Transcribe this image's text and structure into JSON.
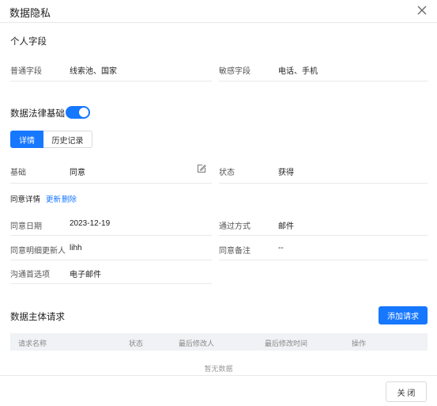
{
  "dialog": {
    "title": "数据隐私",
    "close_icon": "close-icon"
  },
  "personal_fields": {
    "title": "个人字段",
    "normal_label": "普通字段",
    "normal_value": "线索池、国家",
    "sensitive_label": "敏感字段",
    "sensitive_value": "电话、手机"
  },
  "legal_basis": {
    "title": "数据法律基础",
    "toggle_on": true,
    "tabs": [
      {
        "label": "详情",
        "active": true
      },
      {
        "label": "历史记录",
        "active": false
      }
    ],
    "basis_label": "基础",
    "basis_value": "同意",
    "status_label": "状态",
    "status_value": "获得",
    "consent_details_label": "同意详情",
    "update_link": "更新",
    "delete_link": "删除",
    "consent_date_label": "同意日期",
    "consent_date_value": "2023-12-19",
    "via_label": "通过方式",
    "via_value": "邮件",
    "updater_label": "同意明细更新人",
    "updater_value": "lihh",
    "note_label": "同意备注",
    "note_value": "--",
    "comm_pref_label": "沟通首选项",
    "comm_pref_value": "电子邮件"
  },
  "subject_requests": {
    "title": "数据主体请求",
    "add_button": "添加请求",
    "columns": [
      "请求名称",
      "状态",
      "最后修改人",
      "最后修改时间",
      "操作"
    ],
    "empty_text": "暂无数据"
  },
  "footer": {
    "close_button": "关 闭"
  },
  "colors": {
    "primary": "#1677ff",
    "border": "#e8e8e8",
    "table_header_bg": "#f0f2f5"
  }
}
